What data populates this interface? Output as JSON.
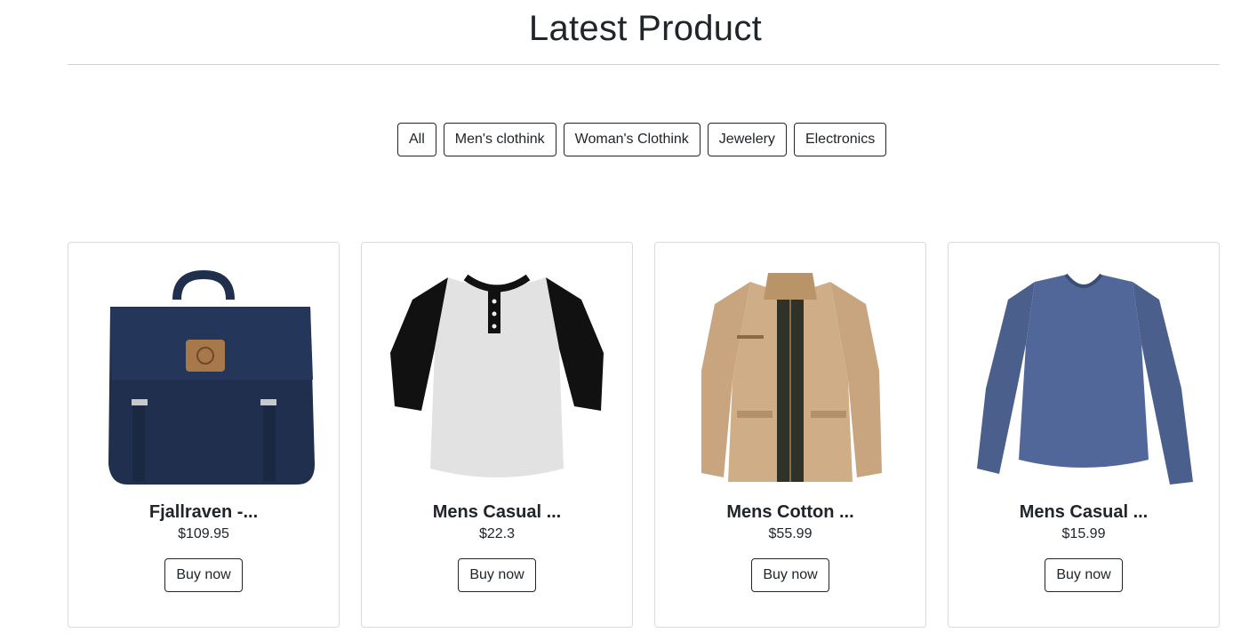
{
  "header": {
    "title": "Latest Product"
  },
  "filters": [
    {
      "label": "All"
    },
    {
      "label": "Men's clothink"
    },
    {
      "label": "Woman's Clothink"
    },
    {
      "label": "Jewelery"
    },
    {
      "label": "Electronics"
    }
  ],
  "products": [
    {
      "title": "Fjallraven -...",
      "price": "$109.95",
      "button": "Buy now",
      "image": "navy-backpack"
    },
    {
      "title": "Mens Casual ...",
      "price": "$22.3",
      "button": "Buy now",
      "image": "raglan-henley-shirt"
    },
    {
      "title": "Mens Cotton ...",
      "price": "$55.99",
      "button": "Buy now",
      "image": "khaki-cotton-jacket"
    },
    {
      "title": "Mens Casual ...",
      "price": "$15.99",
      "button": "Buy now",
      "image": "blue-long-sleeve-shirt"
    }
  ],
  "colors": {
    "text": "#212529",
    "border": "#d8dadd",
    "backpack": "#1f2f4d",
    "shirt_body": "#e2e2e2",
    "shirt_sleeve": "#111111",
    "jacket": "#c8a57e",
    "tee_blue": "#4a5f8c"
  }
}
